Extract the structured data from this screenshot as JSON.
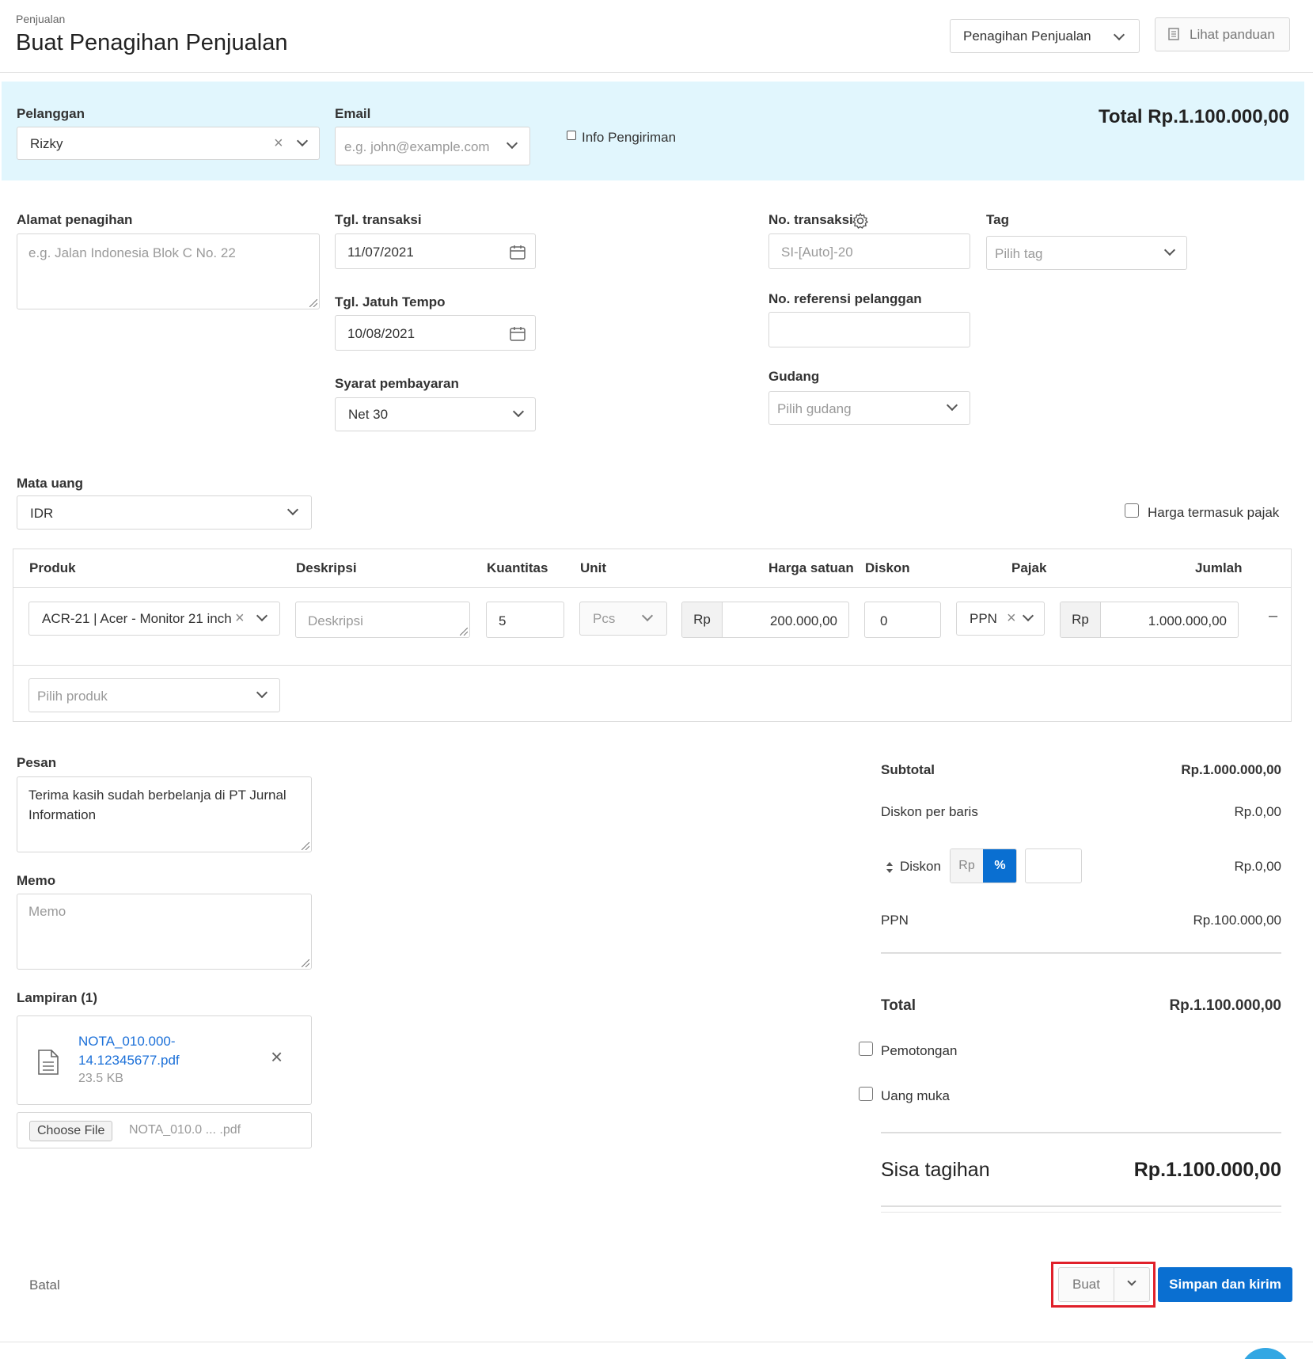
{
  "header": {
    "breadcrumb": "Penjualan",
    "title": "Buat Penagihan Penjualan",
    "type_select": "Penagihan Penjualan",
    "guide_button": "Lihat panduan"
  },
  "customer_band": {
    "customer_label": "Pelanggan",
    "customer_value": "Rizky",
    "email_label": "Email",
    "email_placeholder": "e.g. john@example.com",
    "shipping_info_label": "Info Pengiriman",
    "total_text": "Total Rp.1.100.000,00"
  },
  "form": {
    "billing_address_label": "Alamat penagihan",
    "billing_address_placeholder": "e.g. Jalan Indonesia Blok C No. 22",
    "transaction_date_label": "Tgl. transaksi",
    "transaction_date_value": "11/07/2021",
    "due_date_label": "Tgl. Jatuh Tempo",
    "due_date_value": "10/08/2021",
    "payment_terms_label": "Syarat pembayaran",
    "payment_terms_value": "Net 30",
    "transaction_no_label": "No. transaksi",
    "transaction_no_placeholder": "SI-[Auto]-20",
    "tag_label": "Tag",
    "tag_placeholder": "Pilih tag",
    "customer_ref_label": "No. referensi pelanggan",
    "warehouse_label": "Gudang",
    "warehouse_placeholder": "Pilih gudang",
    "currency_label": "Mata uang",
    "currency_value": "IDR",
    "price_incl_tax_label": "Harga termasuk pajak"
  },
  "table": {
    "headers": [
      "Produk",
      "Deskripsi",
      "Kuantitas",
      "Unit",
      "Harga satuan",
      "Diskon",
      "Pajak",
      "Jumlah"
    ],
    "row": {
      "product": "ACR-21 | Acer - Monitor 21 inch",
      "description_placeholder": "Deskripsi",
      "quantity": "5",
      "unit": "Pcs",
      "price_prefix": "Rp",
      "price": "200.000,00",
      "discount": "0",
      "tax": "PPN",
      "amount_prefix": "Rp",
      "amount": "1.000.000,00",
      "remove": "–"
    },
    "add_product_placeholder": "Pilih produk"
  },
  "notes": {
    "message_label": "Pesan",
    "message_value": "Terima kasih sudah berbelanja di PT Jurnal Information",
    "memo_label": "Memo",
    "memo_placeholder": "Memo",
    "attachments_label": "Lampiran (1)",
    "file_name_line1": "NOTA_010.000-",
    "file_name_line2": "14.12345677.pdf",
    "file_size": "23.5 KB",
    "choose_file_button": "Choose File",
    "chosen_file": "NOTA_010.0 ... .pdf"
  },
  "summary": {
    "subtotal_label": "Subtotal",
    "subtotal_value": "Rp.1.000.000,00",
    "line_discount_label": "Diskon per baris",
    "line_discount_value": "Rp.0,00",
    "discount_label": "Diskon",
    "discount_rp": "Rp",
    "discount_pct": "%",
    "discount_value": "Rp.0,00",
    "tax_label": "PPN",
    "tax_value": "Rp.100.000,00",
    "total_label": "Total",
    "total_value": "Rp.1.100.000,00",
    "withholding_label": "Pemotongan",
    "down_payment_label": "Uang muka",
    "balance_label": "Sisa tagihan",
    "balance_value": "Rp.1.100.000,00"
  },
  "footer": {
    "cancel": "Batal",
    "create": "Buat",
    "save_send": "Simpan dan kirim"
  },
  "colors": {
    "band": "#e1f6fd",
    "primary": "#0a6fd1",
    "link": "#1a6fd8",
    "highlight": "#e0202a"
  }
}
